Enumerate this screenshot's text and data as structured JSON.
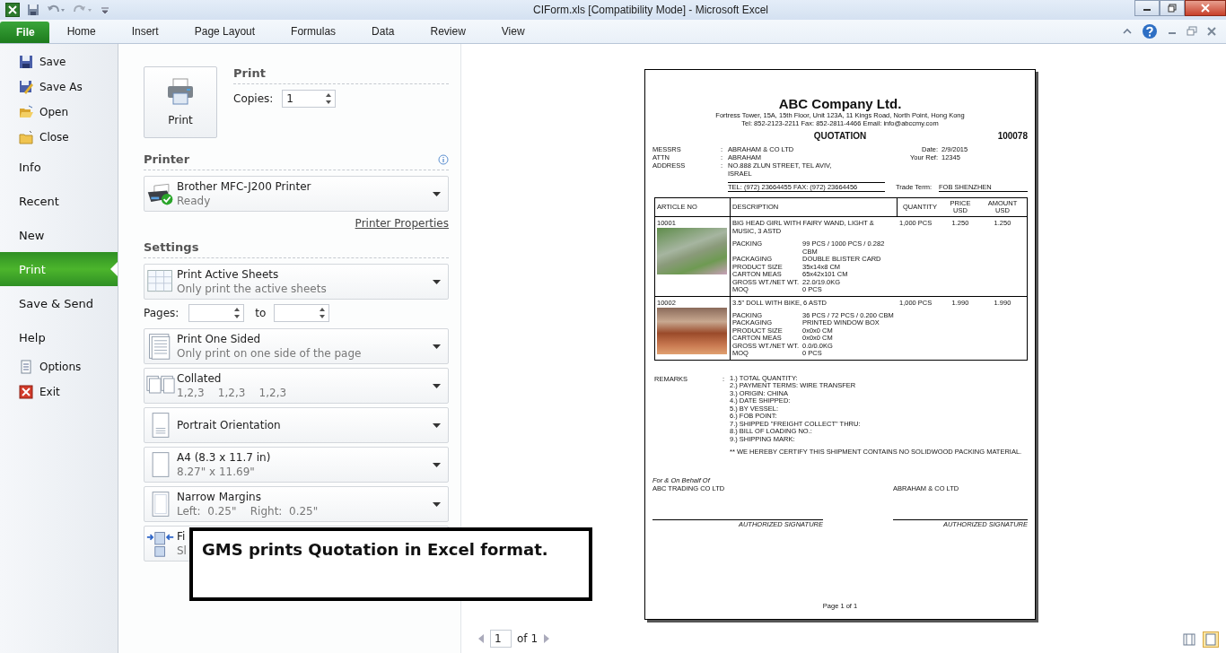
{
  "window": {
    "title": "CIForm.xls  [Compatibility Mode]  -  Microsoft Excel"
  },
  "ribbon_tabs": [
    {
      "label": "File",
      "selected": true
    },
    {
      "label": "Home",
      "selected": false
    },
    {
      "label": "Insert",
      "selected": false
    },
    {
      "label": "Page Layout",
      "selected": false
    },
    {
      "label": "Formulas",
      "selected": false
    },
    {
      "label": "Data",
      "selected": false
    },
    {
      "label": "Review",
      "selected": false
    },
    {
      "label": "View",
      "selected": false
    }
  ],
  "backstage_nav": [
    {
      "label": "Save",
      "kind": "command",
      "selected": false
    },
    {
      "label": "Save As",
      "kind": "command",
      "selected": false
    },
    {
      "label": "Open",
      "kind": "command",
      "selected": false
    },
    {
      "label": "Close",
      "kind": "command",
      "selected": false
    },
    {
      "label": "Info",
      "kind": "page",
      "selected": false
    },
    {
      "label": "Recent",
      "kind": "page",
      "selected": false
    },
    {
      "label": "New",
      "kind": "page",
      "selected": false
    },
    {
      "label": "Print",
      "kind": "page",
      "selected": true
    },
    {
      "label": "Save & Send",
      "kind": "page",
      "selected": false
    },
    {
      "label": "Help",
      "kind": "page",
      "selected": false
    },
    {
      "label": "Options",
      "kind": "command",
      "selected": false
    },
    {
      "label": "Exit",
      "kind": "command",
      "selected": false
    }
  ],
  "print": {
    "heading": "Print",
    "button": "Print",
    "copies_label": "Copies:",
    "copies": "1"
  },
  "printer": {
    "heading": "Printer",
    "name": "Brother MFC-J200 Printer",
    "status": "Ready",
    "properties_link": "Printer Properties"
  },
  "settings": {
    "heading": "Settings",
    "items": [
      {
        "kind": "dropdown",
        "title": "Print Active Sheets",
        "subtitle": "Only print the active sheets"
      },
      {
        "kind": "pages",
        "label": "Pages:",
        "to_label": "to"
      },
      {
        "kind": "dropdown",
        "title": "Print One Sided",
        "subtitle": "Only print on one side of the page"
      },
      {
        "kind": "dropdown",
        "title": "Collated",
        "subtitle": "1,2,3    1,2,3    1,2,3"
      },
      {
        "kind": "dropdown",
        "title": "Portrait Orientation"
      },
      {
        "kind": "dropdown",
        "title": "A4 (8.3 x 11.7 in)",
        "subtitle": "8.27\" x 11.69\""
      },
      {
        "kind": "dropdown",
        "title": "Narrow Margins",
        "subtitle": "Left:  0.25\"    Right:  0.25\""
      },
      {
        "kind": "dropdown",
        "title": "Fi",
        "subtitle": "Sl"
      }
    ]
  },
  "document": {
    "company": "ABC Company Ltd.",
    "address": "Fortress Tower, 15A, 15th Floor, Unit 123A, 11 Kings Road, North Point, Hong Kong",
    "contact": "Tel: 852-2123-2211   Fax: 852-2811-4466   Email: info@abccmy.com",
    "title": "QUOTATION",
    "number": "100078",
    "left_fields": [
      {
        "label": "MESSRS",
        "lines": [
          "ABRAHAM & CO LTD"
        ]
      },
      {
        "label": "ATTN",
        "lines": [
          "ABRAHAM"
        ]
      },
      {
        "label": "ADDRESS",
        "lines": [
          "NO.888 ZLUN STREET, TEL AVIV,",
          "ISRAEL"
        ]
      }
    ],
    "right_fields": [
      {
        "label": "Date:",
        "value": "2/9/2015"
      },
      {
        "label": "Your Ref:",
        "value": "12345"
      }
    ],
    "separator": ":",
    "tel_fax": "TEL: (972) 23664455  FAX: (972) 23664456",
    "trade_term_label": "Trade Term:",
    "trade_term": "FOB SHENZHEN",
    "columns": [
      {
        "lines": [
          "ARTICLE NO"
        ]
      },
      {
        "lines": [
          "DESCRIPTION"
        ]
      },
      {
        "lines": [
          "QUANTITY"
        ]
      },
      {
        "lines": [
          "PRICE",
          "USD"
        ]
      },
      {
        "lines": [
          "AMOUNT",
          "USD"
        ]
      }
    ],
    "rows": [
      {
        "article": "10001",
        "description": "BIG HEAD GIRL WITH FAIRY WAND, LIGHT & MUSIC, 3 ASTD",
        "quantity": "1,000 PCS",
        "price": "1.250",
        "amount": "1.250",
        "specs": [
          {
            "label": "PACKING",
            "value": "99 PCS / 1000 PCS  /  0.282 CBM"
          },
          {
            "label": "PACKAGING",
            "value": "DOUBLE BLISTER CARD"
          },
          {
            "label": "PRODUCT SIZE",
            "value": "35x14x8 CM"
          },
          {
            "label": "CARTON MEAS",
            "value": "65x42x101 CM"
          },
          {
            "label": "GROSS WT./NET WT.",
            "value": "22.0/19.0KG"
          },
          {
            "label": "MOQ",
            "value": "0 PCS"
          }
        ]
      },
      {
        "article": "10002",
        "description": "3.5\" DOLL WITH BIKE, 6 ASTD",
        "quantity": "1,000 PCS",
        "price": "1.990",
        "amount": "1.990",
        "specs": [
          {
            "label": "PACKING",
            "value": "36 PCS / 72 PCS  /  0.200 CBM"
          },
          {
            "label": "PACKAGING",
            "value": "PRINTED WINDOW BOX"
          },
          {
            "label": "PRODUCT SIZE",
            "value": "0x0x0 CM"
          },
          {
            "label": "CARTON MEAS",
            "value": "0x0x0 CM"
          },
          {
            "label": "GROSS WT./NET WT.",
            "value": "0.0/0.0KG"
          },
          {
            "label": "MOQ",
            "value": "0 PCS"
          }
        ]
      }
    ],
    "remarks_label": "REMARKS",
    "remarks": [
      "1.) TOTAL QUANTITY:",
      "2.) PAYMENT TERMS: WIRE TRANSFER",
      "3.) ORIGIN: CHINA",
      "4.) DATE SHIPPED:",
      "5.) BY VESSEL:",
      "6.) FOB POINT:",
      "7.) SHIPPED \"FREIGHT COLLECT\" THRU:",
      "8.) BILL OF LOADING NO.:",
      "9.) SHIPPING MARK:"
    ],
    "certify": "** WE HEREBY CERTIFY THIS SHIPMENT CONTAINS NO SOLIDWOOD PACKING MATERIAL.",
    "behalf": "For & On Behalf Of",
    "seller": "ABC TRADING CO LTD",
    "buyer": "ABRAHAM & CO LTD",
    "signature_labels": [
      "AUTHORIZED SIGNATURE",
      "AUTHORIZED SIGNATURE"
    ],
    "footer": "Page 1 of 1"
  },
  "page_nav": {
    "page": "1",
    "of": "of 1"
  },
  "callout": {
    "text": "GMS prints Quotation in Excel format."
  }
}
